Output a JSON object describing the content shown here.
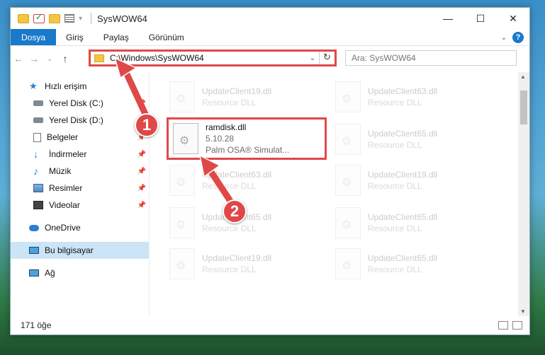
{
  "window": {
    "title": "SysWOW64"
  },
  "ribbon": {
    "tabs": [
      "Dosya",
      "Giriş",
      "Paylaş",
      "Görünüm"
    ]
  },
  "address": {
    "path": "C:\\Windows\\SysWOW64",
    "search_placeholder": "Ara: SysWOW64"
  },
  "nav": {
    "items": [
      {
        "label": "Hızlı erişim",
        "icon": "star-icon"
      },
      {
        "label": "Yerel Disk (C:)",
        "icon": "disk-icon",
        "pinned": true
      },
      {
        "label": "Yerel Disk (D:)",
        "icon": "disk-icon",
        "pinned": true
      },
      {
        "label": "Belgeler",
        "icon": "documents-icon",
        "pinned": true
      },
      {
        "label": "İndirmeler",
        "icon": "download-icon",
        "pinned": true
      },
      {
        "label": "Müzik",
        "icon": "music-icon",
        "pinned": true
      },
      {
        "label": "Resimler",
        "icon": "pictures-icon",
        "pinned": true
      },
      {
        "label": "Videolar",
        "icon": "videos-icon",
        "pinned": true
      },
      {
        "label": "OneDrive",
        "icon": "cloud-icon"
      },
      {
        "label": "Bu bilgisayar",
        "icon": "computer-icon",
        "selected": true
      },
      {
        "label": "Ağ",
        "icon": "network-icon"
      }
    ]
  },
  "files": {
    "highlighted": {
      "name": "ramdisk.dll",
      "version": "5.10.28",
      "company": "Palm OSA® Simulat..."
    },
    "faded": [
      {
        "name": "UpdateClient19.dll",
        "type": "Resource DLL"
      },
      {
        "name": "UpdateClient63.dll",
        "type": "Resource DLL"
      },
      {
        "name": "UpdateClient65.dll",
        "type": "Resource DLL"
      },
      {
        "name": "UpdateClient63.dll",
        "type": "Resource DLL"
      },
      {
        "name": "UpdateClient19.dll",
        "type": "Resource DLL"
      },
      {
        "name": "UpdateClient65.dll",
        "type": "Resource DLL"
      },
      {
        "name": "UpdateClient65.dll",
        "type": "Resource DLL"
      },
      {
        "name": "UpdateClient19.dll",
        "type": "Resource DLL"
      },
      {
        "name": "UpdateClient65.dll",
        "type": "Resource DLL"
      }
    ]
  },
  "status": {
    "count": "171 öğe"
  },
  "callouts": {
    "one": "1",
    "two": "2"
  },
  "colors": {
    "accent": "#1979ca",
    "callout": "#e04848",
    "selection": "#cce4f7"
  }
}
